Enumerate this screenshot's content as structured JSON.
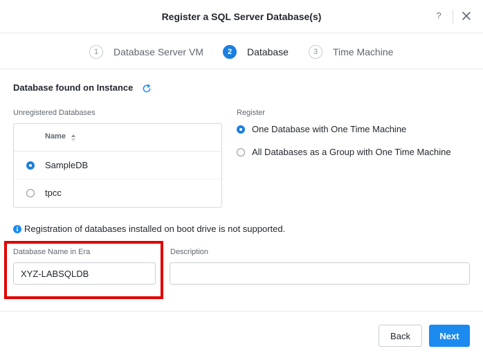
{
  "dialog": {
    "title": "Register a SQL Server Database(s)",
    "help_label": "?"
  },
  "steps": [
    {
      "number": "1",
      "label": "Database Server VM",
      "state": "inactive"
    },
    {
      "number": "2",
      "label": "Database",
      "state": "active"
    },
    {
      "number": "3",
      "label": "Time Machine",
      "state": "inactive"
    }
  ],
  "databases_section": {
    "title": "Database found on Instance",
    "unregistered_label": "Unregistered Databases",
    "column_name": "Name",
    "rows": [
      {
        "name": "SampleDB",
        "selected": true
      },
      {
        "name": "tpcc",
        "selected": false
      }
    ]
  },
  "register": {
    "label": "Register",
    "options": [
      {
        "label": "One Database with One Time Machine",
        "selected": true
      },
      {
        "label": "All Databases as a Group with One Time Machine",
        "selected": false
      }
    ]
  },
  "info_text": "Registration of databases installed on boot drive is not supported.",
  "form": {
    "db_name_label": "Database Name in Era",
    "db_name_value": "XYZ-LABSQLDB",
    "description_label": "Description",
    "description_value": ""
  },
  "footer": {
    "back_label": "Back",
    "next_label": "Next"
  },
  "colors": {
    "accent": "#1b8bf0",
    "highlight_box": "#e00000"
  },
  "icons": [
    "close-icon",
    "refresh-icon",
    "sort-icon",
    "info-icon"
  ]
}
